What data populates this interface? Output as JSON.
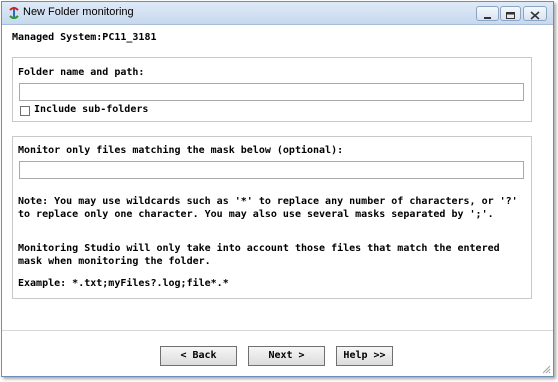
{
  "window": {
    "title": "New Folder monitoring",
    "controls": [
      "minimize",
      "maximize",
      "close"
    ]
  },
  "managed_system": "Managed System:PC11_3181",
  "folder_group": {
    "label": "Folder name and path:",
    "value": "",
    "include_subfolders_label": "Include sub-folders",
    "include_subfolders_checked": false
  },
  "mask_group": {
    "label": "Monitor only files matching the mask below (optional):",
    "value": "",
    "note1": "Note: You may use wildcards such as '*' to replace any number of characters, or '?' to replace only one character. You may also use several masks separated by ';'.",
    "note2": "Monitoring Studio will only take into account those files that match the entered mask when monitoring the folder.",
    "example": "Example: *.txt;myFiles?.log;file*.*"
  },
  "buttons": {
    "back": "< Back",
    "next": "Next >",
    "help": "Help >>"
  }
}
